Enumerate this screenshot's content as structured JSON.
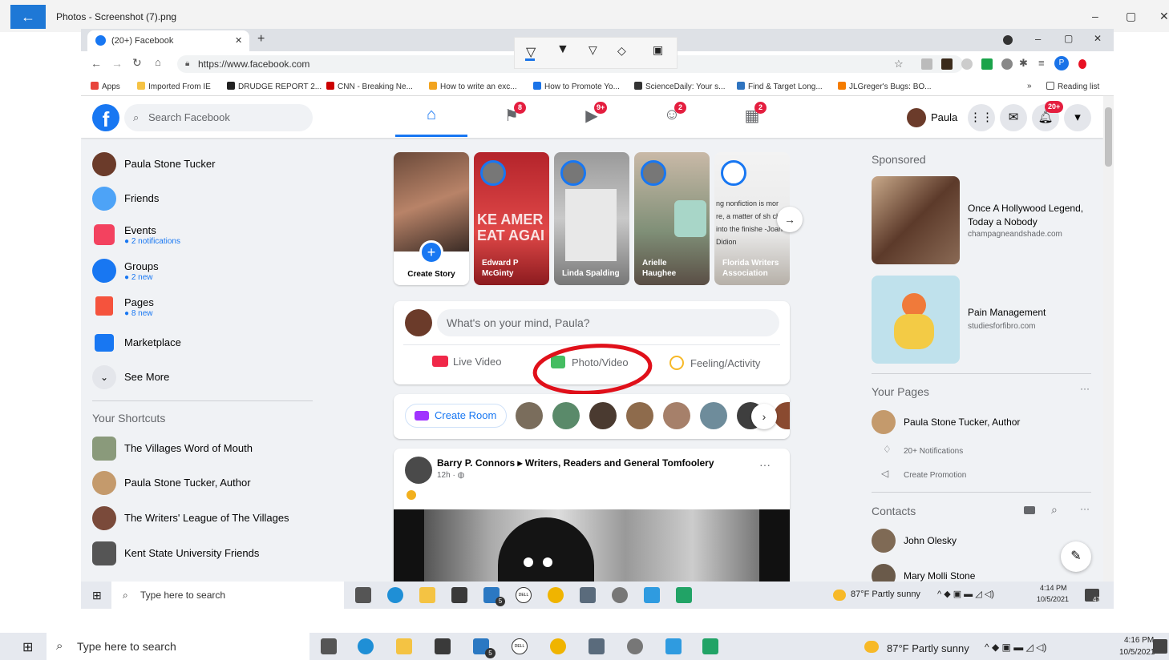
{
  "photos_app": {
    "title": "Photos - Screenshot (7).png",
    "back_glyph": "←",
    "minimize_glyph": "–",
    "maximize_glyph": "▢",
    "close_glyph": "✕"
  },
  "browser": {
    "tab_title": "(20+) Facebook",
    "tab_close": "✕",
    "new_tab": "+",
    "url": "https://www.facebook.com",
    "bookmarks": [
      {
        "label": "Apps",
        "color": "#e8453c"
      },
      {
        "label": "Imported From IE",
        "color": "#f6c344"
      },
      {
        "label": "DRUDGE REPORT 2...",
        "color": "#222222"
      },
      {
        "label": "CNN - Breaking Ne...",
        "color": "#cc0000"
      },
      {
        "label": "How to write an exc...",
        "color": "#f2a41f"
      },
      {
        "label": "How to Promote Yo...",
        "color": "#1a73e8"
      },
      {
        "label": "ScienceDaily: Your s...",
        "color": "#333333"
      },
      {
        "label": "Find & Target Long...",
        "color": "#2f74c0"
      },
      {
        "label": "JLGreger's Bugs: BO...",
        "color": "#f57c00"
      }
    ],
    "reading_list": "Reading list",
    "more_bookmarks": "»"
  },
  "facebook": {
    "search_placeholder": "Search Facebook",
    "badges": {
      "pages": "8",
      "watch": "9+",
      "groups": "2",
      "events": "2",
      "notifications": "20+"
    },
    "profile_name": "Paula",
    "left_menu": [
      {
        "label": "Paula Stone Tucker",
        "sub": ""
      },
      {
        "label": "Friends",
        "sub": ""
      },
      {
        "label": "Events",
        "sub": "2 notifications"
      },
      {
        "label": "Groups",
        "sub": "2 new"
      },
      {
        "label": "Pages",
        "sub": "8 new"
      },
      {
        "label": "Marketplace",
        "sub": ""
      },
      {
        "label": "See More",
        "sub": ""
      }
    ],
    "shortcuts_title": "Your Shortcuts",
    "shortcuts": [
      "The Villages Word of Mouth",
      "Paula Stone Tucker, Author",
      "The Writers' League of The Villages",
      "Kent State University Friends"
    ],
    "stories": [
      {
        "name": "Create Story"
      },
      {
        "name": "Edward P McGinty"
      },
      {
        "name": "Linda Spalding"
      },
      {
        "name": "Arielle Haughee"
      },
      {
        "name": "Florida Writers Association"
      }
    ],
    "story_quote": "ng nonfiction is mor re, a matter of sh ch into the finishe -Joan Didion",
    "story_banner": "KE AMER EAT AGAI",
    "composer_placeholder": "What's on your mind, Paula?",
    "composer_actions": {
      "live": "Live Video",
      "photo": "Photo/Video",
      "feeling": "Feeling/Activity"
    },
    "create_room": "Create Room",
    "post": {
      "author": "Barry P. Connors",
      "arrow": "▸",
      "group": "Writers, Readers and General Tomfoolery",
      "meta": "12h · ◍",
      "more": "···"
    },
    "sponsored_title": "Sponsored",
    "ads": [
      {
        "title": "Once A Hollywood Legend, Today a Nobody",
        "domain": "champagneandshade.com"
      },
      {
        "title": "Pain Management",
        "domain": "studiesforfibro.com"
      }
    ],
    "your_pages_title": "Your Pages",
    "page_name": "Paula Stone Tucker, Author",
    "notifications_link": "20+ Notifications",
    "create_promotion": "Create Promotion",
    "contacts_title": "Contacts",
    "contacts": [
      "John Olesky",
      "Mary Molli Stone"
    ],
    "more_dots": "···"
  },
  "taskbar": {
    "search_placeholder": "Type here to search",
    "weather": "87°F  Partly sunny",
    "inner_time": "4:14 PM",
    "inner_date": "10/5/2021",
    "outer_time": "4:16 PM",
    "outer_date": "10/5/2021",
    "notif_count": "47",
    "mail_count": "5",
    "dell_label": "DELL"
  },
  "annotation": {
    "color": "#e0101a",
    "shape": "ellipse"
  }
}
